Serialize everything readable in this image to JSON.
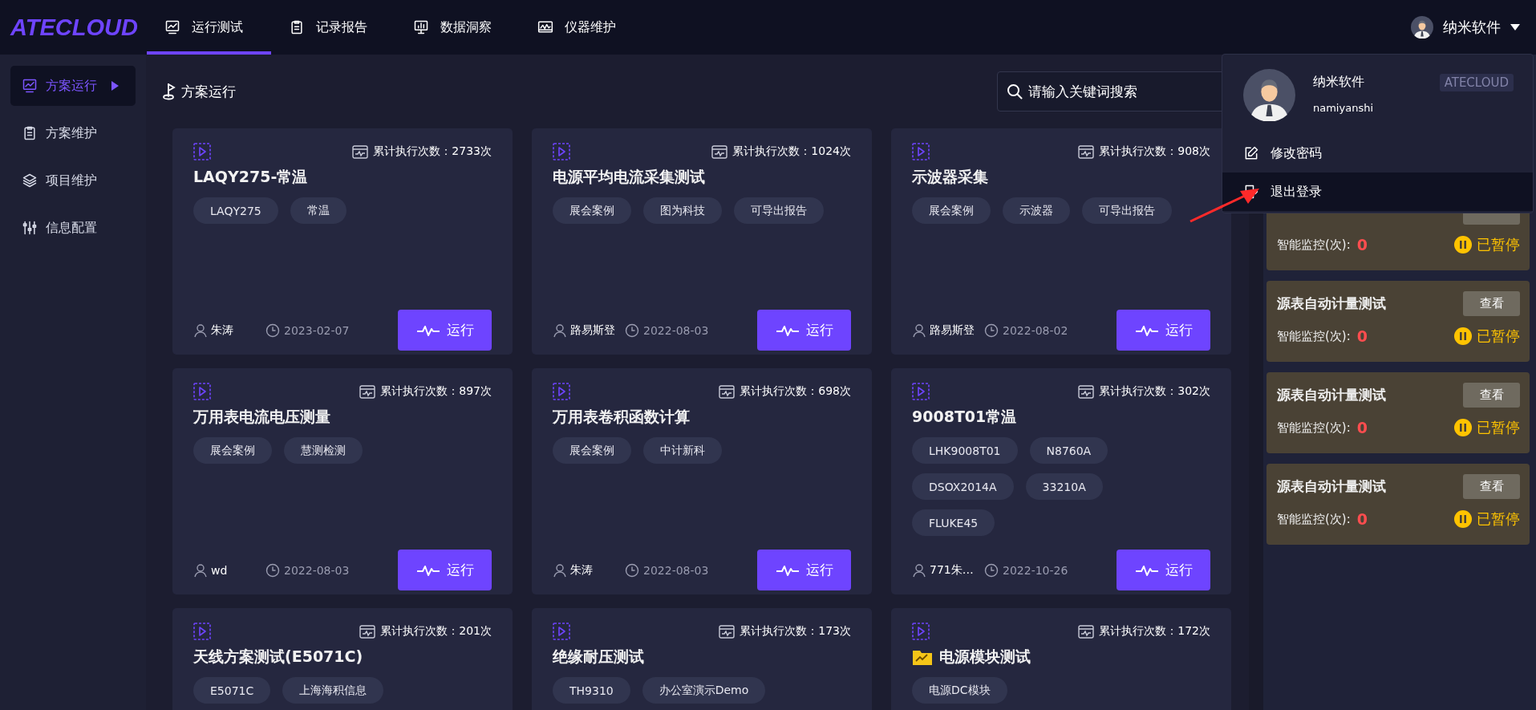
{
  "logo": "ATECLOUD",
  "nav": [
    {
      "label": "运行测试",
      "selected": true
    },
    {
      "label": "记录报告",
      "selected": false
    },
    {
      "label": "数据洞察",
      "selected": false
    },
    {
      "label": "仪器维护",
      "selected": false
    }
  ],
  "user": {
    "name": "纳米软件"
  },
  "sidebar": {
    "items": [
      {
        "label": "方案运行",
        "selected": true
      },
      {
        "label": "方案维护",
        "selected": false
      },
      {
        "label": "项目维护",
        "selected": false
      },
      {
        "label": "信息配置",
        "selected": false
      }
    ]
  },
  "page_title": "方案运行",
  "search": {
    "placeholder": "请输入关键词搜索"
  },
  "cards": [
    {
      "count": "累计执行次数：2733次",
      "title": "LAQY275-常温",
      "folder": false,
      "tags": [
        "LAQY275",
        "常温"
      ],
      "author": "朱涛",
      "date": "2023-02-07",
      "button": "运行"
    },
    {
      "count": "累计执行次数：1024次",
      "title": "电源平均电流采集测试",
      "folder": false,
      "tags": [
        "展会案例",
        "图为科技",
        "可导出报告"
      ],
      "author": "路易斯登",
      "date": "2022-08-03",
      "button": "运行"
    },
    {
      "count": "累计执行次数：908次",
      "title": "示波器采集",
      "folder": false,
      "tags": [
        "展会案例",
        "示波器",
        "可导出报告"
      ],
      "author": "路易斯登",
      "date": "2022-08-02",
      "button": "运行"
    },
    {
      "count": "累计执行次数：897次",
      "title": "万用表电流电压测量",
      "folder": false,
      "tags": [
        "展会案例",
        "慧测检测"
      ],
      "author": "wd",
      "date": "2022-08-03",
      "button": "运行"
    },
    {
      "count": "累计执行次数：698次",
      "title": "万用表卷积函数计算",
      "folder": false,
      "tags": [
        "展会案例",
        "中计新科"
      ],
      "author": "朱涛",
      "date": "2022-08-03",
      "button": "运行"
    },
    {
      "count": "累计执行次数：302次",
      "title": "9008T01常温",
      "folder": false,
      "tags": [
        "LHK9008T01",
        "N8760A",
        "DSOX2014A",
        "33210A",
        "FLUKE45"
      ],
      "author": "771朱…",
      "date": "2022-10-26",
      "button": "运行"
    },
    {
      "count": "累计执行次数：201次",
      "title": "天线方案测试(E5071C)",
      "folder": false,
      "tags": [
        "E5071C",
        "上海海积信息"
      ]
    },
    {
      "count": "累计执行次数：173次",
      "title": "绝缘耐压测试",
      "folder": false,
      "tags": [
        "TH9310",
        "办公室演示Demo"
      ]
    },
    {
      "count": "累计执行次数：172次",
      "title": "电源模块测试",
      "folder": true,
      "tags": [
        "电源DC模块"
      ]
    }
  ],
  "monitors": [
    {
      "label": "智能监控(次):",
      "value": "0",
      "status": "已暂停",
      "kind": "paused"
    },
    {
      "title": "源表自动计量测试",
      "button": "查看",
      "label": "智能监控(次):",
      "value": "0",
      "status": "已暂停",
      "kind": "paused"
    },
    {
      "title": "源表自动计量测试",
      "button": "查看",
      "label": "智能监控(次):",
      "value": "0",
      "status": "已暂停",
      "kind": "paused"
    },
    {
      "title": "源表自动计量测试",
      "button": "查看",
      "label": "智能监控(次):",
      "value": "0",
      "status": "已暂停",
      "kind": "paused"
    }
  ],
  "user_menu": {
    "name": "纳米软件",
    "account": "namiyanshi",
    "badge": "ATECLOUD",
    "items": [
      {
        "label": "修改密码",
        "selected": false
      },
      {
        "label": "退出登录",
        "selected": true
      }
    ]
  }
}
